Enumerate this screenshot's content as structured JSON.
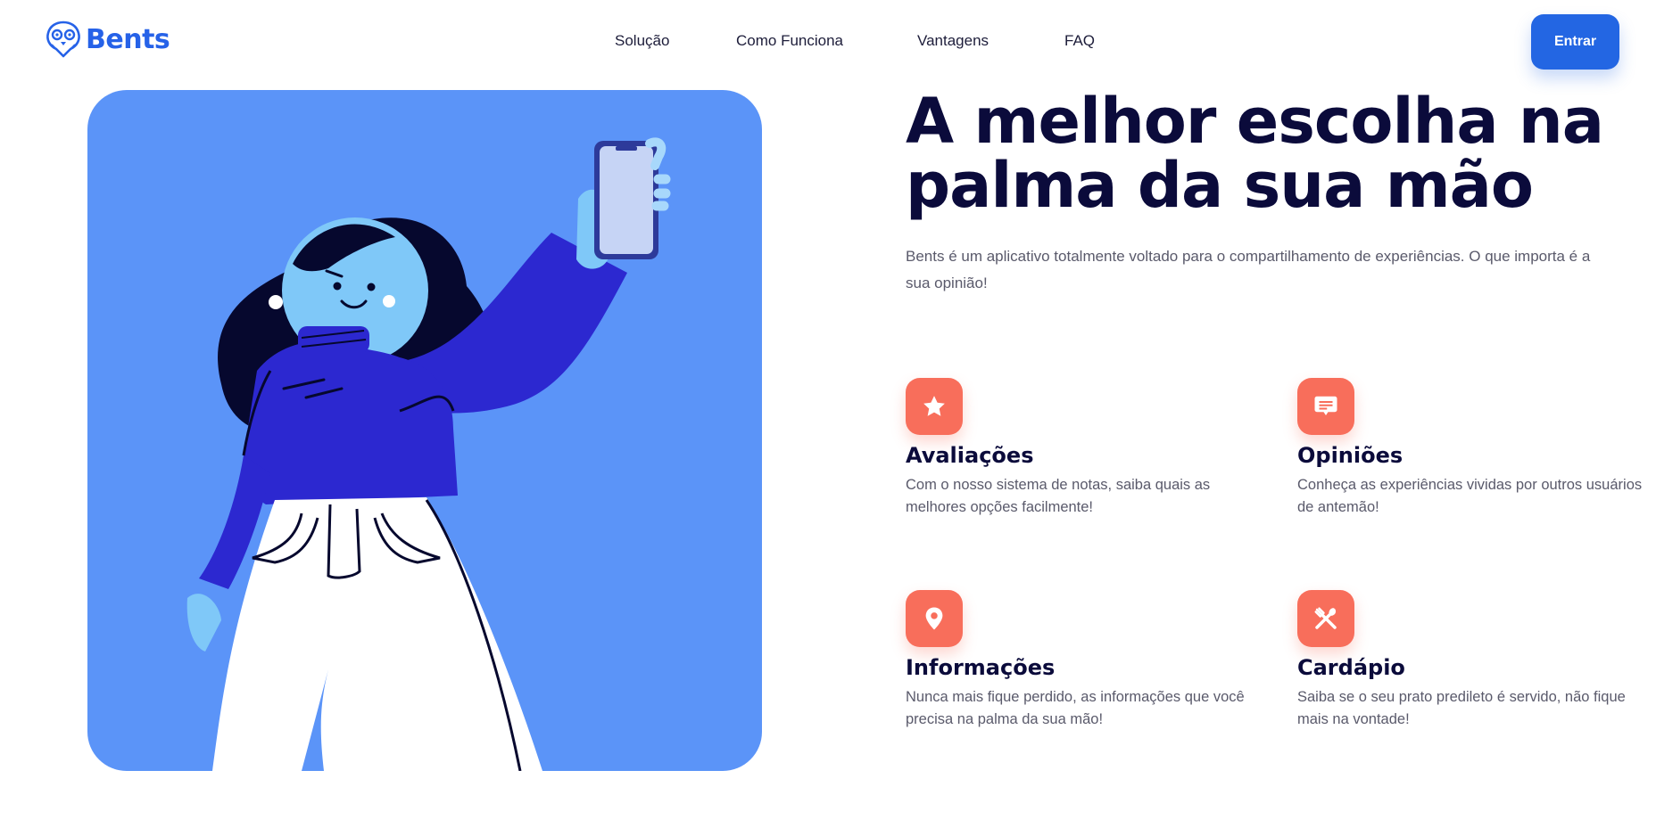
{
  "brand": {
    "name": "Bents",
    "logo_icon": "owl-mascot-icon",
    "color": "#2662e8"
  },
  "nav": {
    "items": [
      "Solução",
      "Como Funciona",
      "Vantagens",
      "FAQ"
    ],
    "cta_label": "Entrar"
  },
  "hero": {
    "title": "A melhor escolha na palma da sua mão",
    "description": "Bents é um aplicativo totalmente voltado para o compartilhamento de experiências. O que importa é a sua opinião!",
    "illustration": "woman-holding-phone-illustration",
    "card_color": "#5b94f8"
  },
  "features": [
    {
      "icon": "star-icon",
      "title": "Avaliações",
      "text": "Com o nosso sistema de notas, saiba quais as melhores opções facilmente!"
    },
    {
      "icon": "message-icon",
      "title": "Opiniões",
      "text": "Conheça as experiências vividas por outros usuários de antemão!"
    },
    {
      "icon": "location-pin-icon",
      "title": "Informações",
      "text": "Nunca mais fique perdido, as informações que você precisa na palma da sua mão!"
    },
    {
      "icon": "utensils-icon",
      "title": "Cardápio",
      "text": "Saiba se o seu prato predileto é servido, não fique mais na vontade!"
    }
  ],
  "colors": {
    "accent": "#2366e3",
    "feature_icon_bg": "#f86e5b",
    "heading": "#0b0b3b",
    "body_text": "#5a5a6b"
  }
}
